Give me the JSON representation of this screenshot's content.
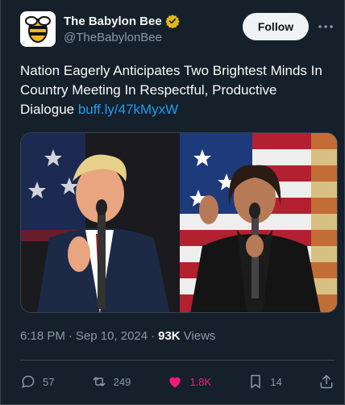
{
  "account": {
    "name": "The Babylon Bee",
    "handle": "@TheBabylonBee",
    "follow_label": "Follow"
  },
  "tweet": {
    "text": "Nation Eagerly Anticipates Two Brightest Minds In Country Meeting In Respectful, Productive Dialogue",
    "link": "buff.ly/47kMyxW"
  },
  "meta": {
    "time": "6:18 PM",
    "date": "Sep 10, 2024",
    "views_count": "93K",
    "views_label": "Views"
  },
  "actions": {
    "replies": "57",
    "reposts": "249",
    "likes": "1.8K",
    "bookmarks": "14"
  },
  "colors": {
    "background": "#15202b",
    "link": "#1d9bf0",
    "like": "#f91880",
    "muted": "#8b98a5",
    "verified": "#e2b719"
  }
}
